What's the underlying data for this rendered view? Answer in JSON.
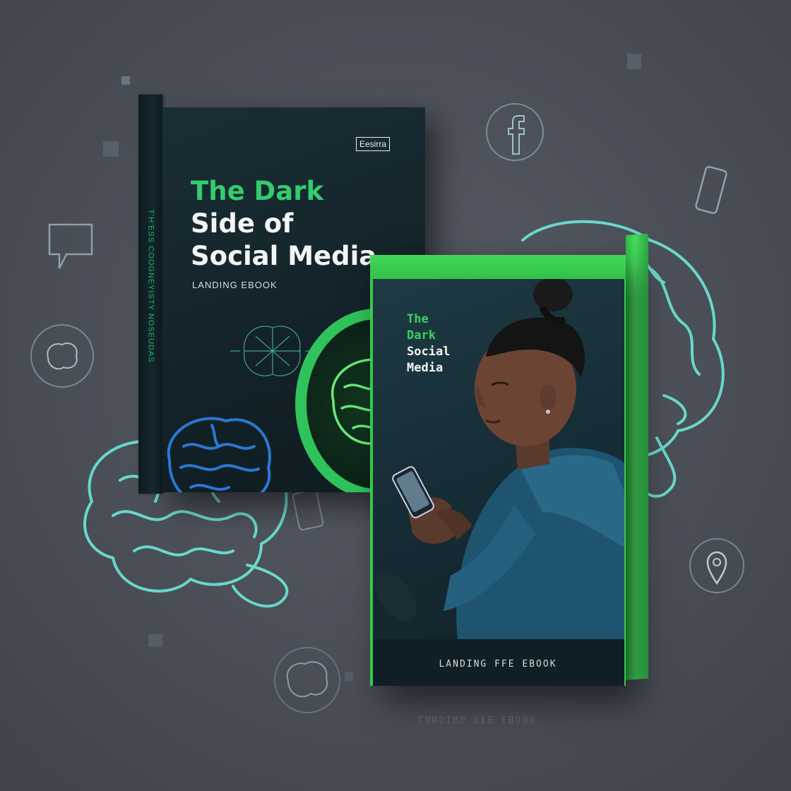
{
  "scene": {
    "background_color": "#4b4f58",
    "accent_green": "#33cc6e",
    "glow_cyan": "#5fe3d2"
  },
  "book_back": {
    "brand": "Eesirra",
    "title_line1": "The Dark",
    "title_line2": "Side of",
    "title_line3": "Social Media",
    "subtitle": "LANDING EBOOK",
    "spine_text": "T'H'ESS  COOGNEYISTY NOSEUDAS"
  },
  "book_front": {
    "title_line1": "The",
    "title_line2": "Dark",
    "title_line3": "Social",
    "title_line4": "Media",
    "footer": "LANDING FFE EBOOK"
  },
  "reflection": {
    "text": "LANDING FFE EBOOK"
  },
  "icons": [
    "facebook-icon",
    "smartphone-icon",
    "chat-bubble-icon",
    "brain-circle-icon",
    "location-pin-icon",
    "brain-outline-icon"
  ]
}
